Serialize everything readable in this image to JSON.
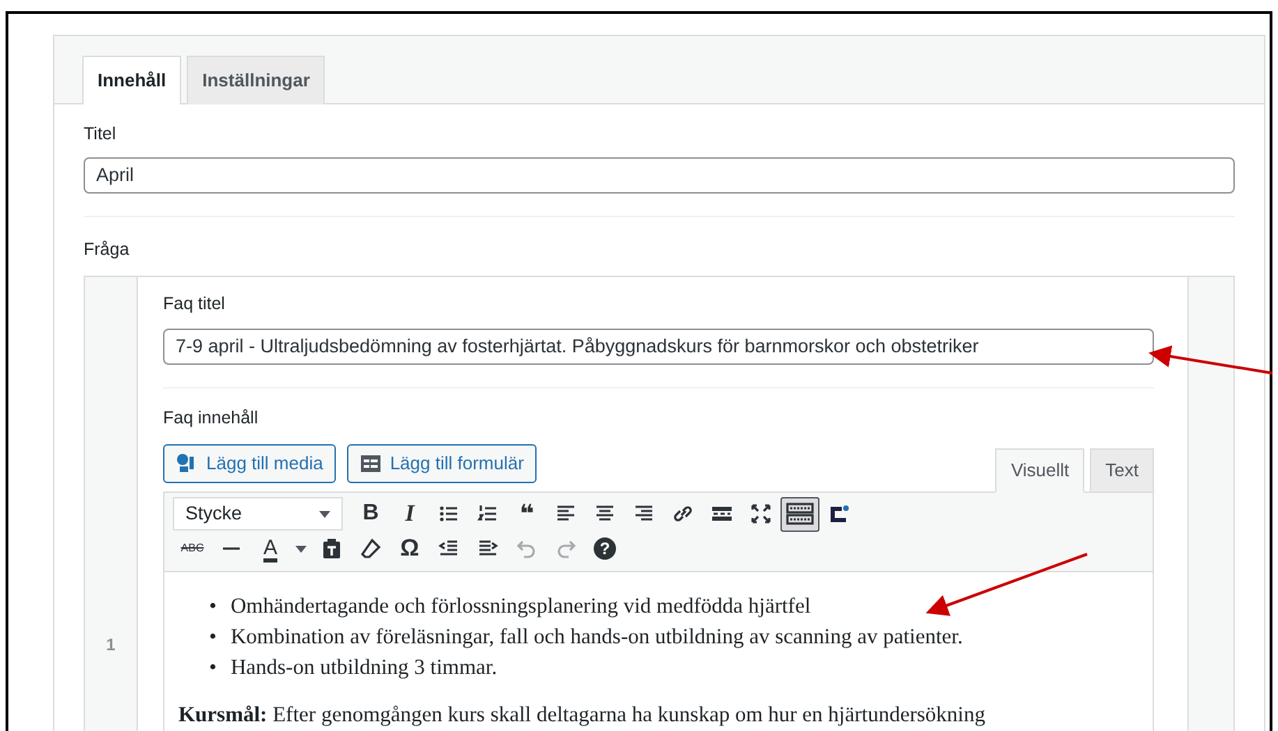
{
  "tabs": [
    {
      "label": "Innehåll",
      "selected": true
    },
    {
      "label": "Inställningar",
      "selected": false
    }
  ],
  "title_field": {
    "label": "Titel",
    "value": "April"
  },
  "question": {
    "label": "Fråga",
    "row_number": "1",
    "faq_title": {
      "label": "Faq titel",
      "value": "7-9 april - Ultraljudsbedömning av fosterhjärtat. Påbyggnadskurs för barnmorskor och obstetriker"
    },
    "faq_content": {
      "label": "Faq innehåll",
      "media_buttons": [
        {
          "kind": "media",
          "label": "Lägg till media"
        },
        {
          "kind": "form",
          "label": "Lägg till formulär"
        }
      ],
      "editor_tabs": [
        {
          "label": "Visuellt",
          "selected": true
        },
        {
          "label": "Text",
          "selected": false
        }
      ],
      "format_select": "Stycke",
      "toolbar_rows": [
        [
          {
            "kind": "bold",
            "text": "B",
            "pressed": false
          },
          {
            "kind": "italic",
            "text": "I",
            "pressed": false
          },
          {
            "kind": "bullets",
            "pressed": false
          },
          {
            "kind": "numbers",
            "pressed": false
          },
          {
            "kind": "quote",
            "text": "❝",
            "pressed": false
          },
          {
            "kind": "align-left",
            "pressed": false
          },
          {
            "kind": "align-center",
            "pressed": false
          },
          {
            "kind": "align-right",
            "pressed": false
          },
          {
            "kind": "link",
            "pressed": false
          },
          {
            "kind": "more",
            "pressed": false
          },
          {
            "kind": "fullscreen",
            "pressed": false
          },
          {
            "kind": "toolbar-toggle",
            "pressed": true
          },
          {
            "kind": "plugin",
            "pressed": false
          }
        ],
        [
          {
            "kind": "strike",
            "text": "ABC",
            "pressed": false
          },
          {
            "kind": "hr",
            "pressed": false
          },
          {
            "kind": "color",
            "text": "A",
            "pressed": false
          },
          {
            "kind": "paste",
            "pressed": false
          },
          {
            "kind": "eraser",
            "pressed": false
          },
          {
            "kind": "omega",
            "text": "Ω",
            "pressed": false
          },
          {
            "kind": "outdent",
            "pressed": false
          },
          {
            "kind": "indent",
            "pressed": false
          },
          {
            "kind": "undo",
            "pressed": false,
            "disabled": true
          },
          {
            "kind": "redo",
            "pressed": false,
            "disabled": true
          },
          {
            "kind": "help",
            "text": "?",
            "pressed": false
          }
        ]
      ],
      "bullets": [
        {
          "marker": "•",
          "text": "Omhändertagande och förlossningsplanering vid medfödda hjärtfel"
        },
        {
          "marker": "•",
          "text": "Kombination av föreläsningar, fall och hands-on utbildning av scanning av patienter."
        },
        {
          "marker": "•",
          "text": "Hands-on utbildning 3 timmar."
        }
      ],
      "paragraph": "**Kursmål:** Efter genomgången kurs skall deltagarna ha kunskap om hur en hjärtundersökning"
    }
  }
}
